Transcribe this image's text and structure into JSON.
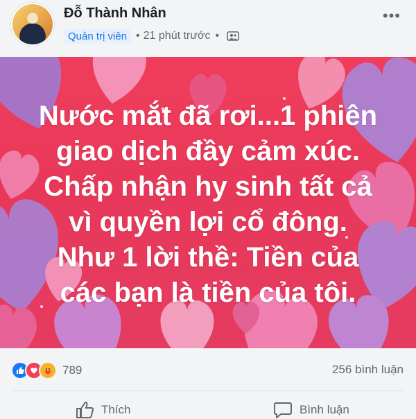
{
  "post": {
    "author_name": "Đỗ Thành Nhân",
    "role_badge": "Quản trị viên",
    "time": "21 phút trước",
    "dot": "•",
    "audience_icon": "group-icon",
    "more_icon": "more-options-icon"
  },
  "banner": {
    "lines": [
      "Nước mắt đã rơi...1 phiên",
      "giao dịch đầy cảm xúc.",
      "Chấp nhận hy sinh tất cả",
      "vì quyền lợi cổ đông.",
      "Như 1 lời thề: Tiền của",
      "các bạn là tiền của tôi."
    ],
    "background_color": "#ec3a5a"
  },
  "engagement": {
    "reaction_icons": [
      "like-icon",
      "love-icon",
      "care-icon"
    ],
    "reaction_count": "789",
    "comments": "256 bình luận"
  },
  "actions": {
    "like_label": "Thích",
    "comment_label": "Bình luận"
  },
  "colors": {
    "like": "#1877f2",
    "love": "#f33e58",
    "care": "#f7b125",
    "badge_text": "#1b74e4",
    "badge_bg": "#e7f0fd"
  }
}
